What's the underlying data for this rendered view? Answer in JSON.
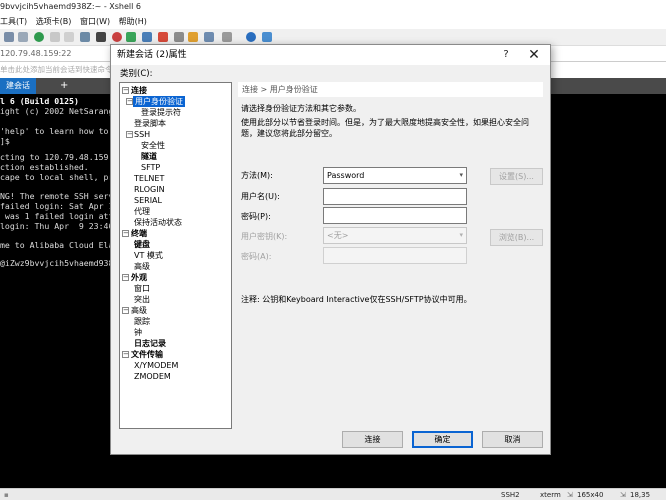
{
  "window": {
    "title": "9bvvjcih5vhaemd938Z:~ - Xshell 6",
    "menu": [
      "工具(T)",
      "选项卡(B)",
      "窗口(W)",
      "帮助(H)"
    ],
    "address": "120.79.48.159:22",
    "hint": "单击此处添加当前会话到快速命令栏。"
  },
  "session_tab": {
    "label": "建会话",
    "add": "+"
  },
  "terminal": {
    "lines": [
      "l 6 (Build 0125)",
      "ight (c) 2002 NetSarang",
      "",
      "'help' to learn how to",
      "]$",
      "",
      "cting to 120.79.48.159:2",
      "ction established.",
      "cape to local shell, pre",
      "",
      "NG! The remote SSH serve",
      "failed login: Sat Apr 11",
      " was 1 failed login atte",
      "login: Thu Apr  9 23:46:",
      "",
      "me to Alibaba Cloud Elas",
      "",
      "@iZwz9bvvjcih5vhaemd938Z"
    ]
  },
  "statusbar": {
    "protocol": "SSH2",
    "term": "xterm",
    "size": "165x40",
    "pos": "18,35"
  },
  "dialog": {
    "title": "新建会话 (2)属性",
    "help": "?",
    "close": "✕",
    "category_label": "类别(C):",
    "tree": [
      {
        "label": "连接",
        "level": 0,
        "bold": true,
        "twisty": "−"
      },
      {
        "label": "用户身份验证",
        "level": 1,
        "selected": true,
        "twisty": "−"
      },
      {
        "label": "登录提示符",
        "level": 2
      },
      {
        "label": "登录脚本",
        "level": 1
      },
      {
        "label": "SSH",
        "level": 1,
        "twisty": "−"
      },
      {
        "label": "安全性",
        "level": 2
      },
      {
        "label": "隧道",
        "level": 2
      },
      {
        "label": "SFTP",
        "level": 2
      },
      {
        "label": "TELNET",
        "level": 1
      },
      {
        "label": "RLOGIN",
        "level": 1
      },
      {
        "label": "SERIAL",
        "level": 1
      },
      {
        "label": "代理",
        "level": 1
      },
      {
        "label": "保持活动状态",
        "level": 1
      },
      {
        "label": "终端",
        "level": 0,
        "bold": true,
        "twisty": "−"
      },
      {
        "label": "键盘",
        "level": 1,
        "bold": true
      },
      {
        "label": "VT 模式",
        "level": 1
      },
      {
        "label": "高级",
        "level": 1
      },
      {
        "label": "外观",
        "level": 0,
        "bold": true,
        "twisty": "−"
      },
      {
        "label": "窗口",
        "level": 1
      },
      {
        "label": "突出",
        "level": 1
      },
      {
        "label": "高级",
        "level": 0,
        "twisty": "−"
      },
      {
        "label": "跟踪",
        "level": 1
      },
      {
        "label": "钟",
        "level": 1
      },
      {
        "label": "日志记录",
        "level": 1,
        "bold": true
      },
      {
        "label": "文件传输",
        "level": 0,
        "bold": true,
        "twisty": "−"
      },
      {
        "label": "X/YMODEM",
        "level": 1
      },
      {
        "label": "ZMODEM",
        "level": 1
      }
    ],
    "breadcrumb": "连接 > 用户身份验证",
    "desc1": "请选择身份验证方法和其它参数。",
    "desc2": "使用此部分以节省登录时间。但是，为了最大限度地提高安全性，如果担心安全问题，建议您将此部分留空。",
    "method_label": "方法(M):",
    "method_value": "Password",
    "settings_btn": "设置(S)...",
    "username_label": "用户名(U):",
    "password_label": "密码(P):",
    "userkey_label": "用户密钥(K):",
    "userkey_value": "<无>",
    "browse_btn": "浏览(B)...",
    "passphrase_label": "密码(A):",
    "note": "注释: 公钥和Keyboard Interactive仅在SSH/SFTP协议中可用。",
    "connect_btn": "连接",
    "ok_btn": "确定",
    "cancel_btn": "取消"
  }
}
